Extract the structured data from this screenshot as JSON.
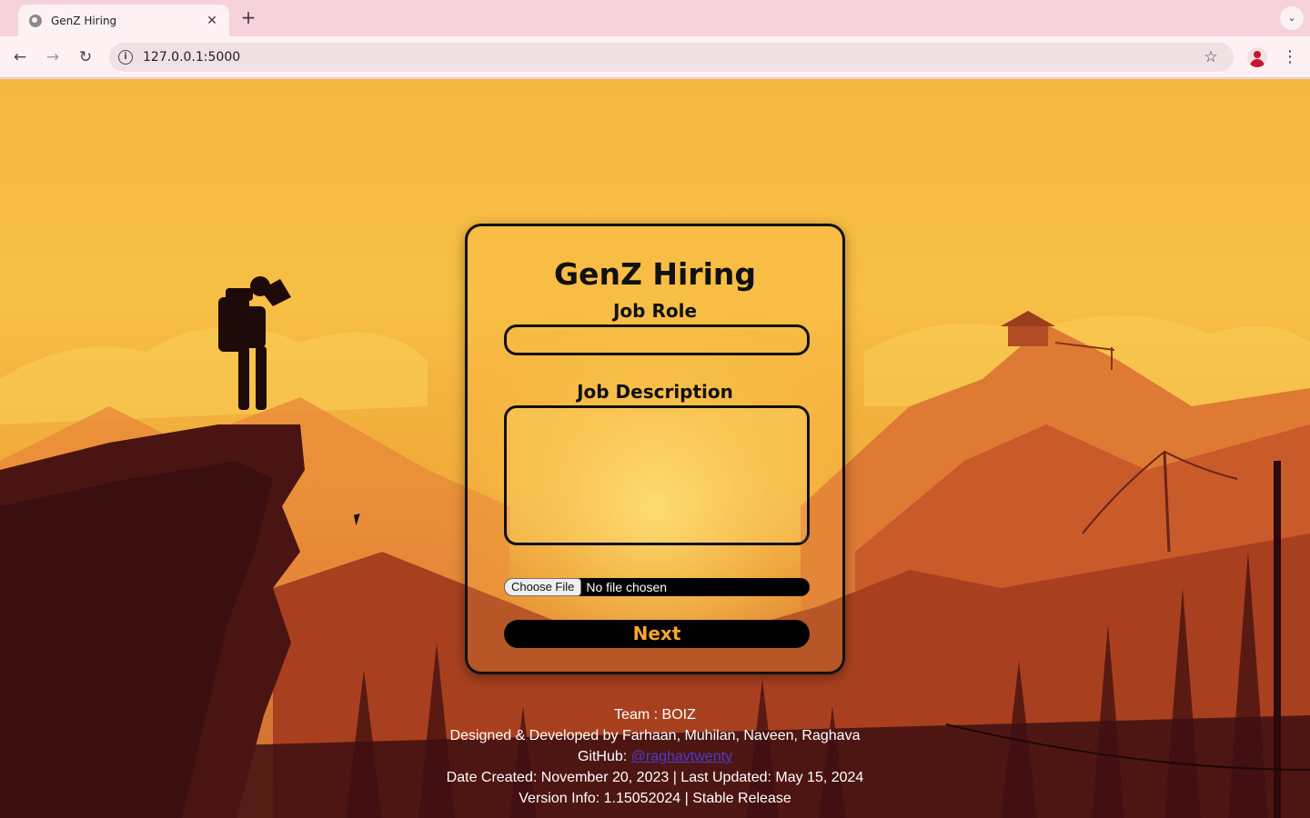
{
  "browser": {
    "tab_title": "GenZ Hiring",
    "tab_close": "✕",
    "new_tab": "+",
    "tab_list": "⌄",
    "url": "127.0.0.1:5000",
    "back": "←",
    "forward": "→",
    "reload": "↻",
    "site_info": "i",
    "bookmark": "☆",
    "menu": "⋮"
  },
  "form": {
    "title": "GenZ Hiring",
    "job_role_label": "Job Role",
    "job_role_value": "",
    "job_description_label": "Job Description",
    "job_description_value": "",
    "choose_file_label": "Choose File",
    "file_status": "No file chosen",
    "next_label": "Next"
  },
  "footer": {
    "team": "Team : BOIZ",
    "credits": "Designed & Developed by Farhaan, Muhilan, Naveen, Raghava",
    "github_prefix": "GitHub: ",
    "github_link": "@raghavtwenty",
    "dates": "Date Created: November 20, 2023 | Last Updated: May 15, 2024",
    "version": "Version Info: 1.15052024 | Stable Release"
  },
  "colors": {
    "sky": "#f5b742",
    "button_text": "#f5a631",
    "link": "#4a3bcc"
  }
}
